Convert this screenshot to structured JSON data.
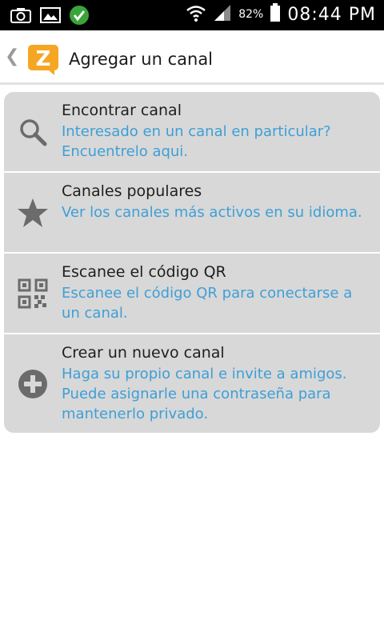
{
  "status_bar": {
    "battery_percent": "82%",
    "time": "08:44 PM",
    "icons": [
      "camera-icon",
      "gallery-icon",
      "check-icon",
      "wifi-icon",
      "signal-icon",
      "battery-icon"
    ]
  },
  "action_bar": {
    "title": "Agregar un canal",
    "back_icon": "chevron-left-icon",
    "logo_letter": "Z",
    "logo_color": "#f5a623"
  },
  "menu": {
    "items": [
      {
        "title": "Encontrar canal",
        "description": "Interesado en un canal en particular? Encuentrelo aqui.",
        "icon": "search-icon"
      },
      {
        "title": "Canales populares",
        "description": "Ver los canales más activos en su idioma.",
        "icon": "star-icon"
      },
      {
        "title": "Escanee el código QR",
        "description": "Escanee el código QR para conectarse a un canal.",
        "icon": "qr-code-icon"
      },
      {
        "title": "Crear un nuevo canal",
        "description": "Haga su propio canal e invite a amigos. Puede asignarle una contraseña para mantenerlo privado.",
        "icon": "add-circle-icon"
      }
    ]
  },
  "colors": {
    "accent_text": "#3e9fd6",
    "card_background": "#d8d8d8",
    "icon_gray": "#6b6b6b"
  }
}
